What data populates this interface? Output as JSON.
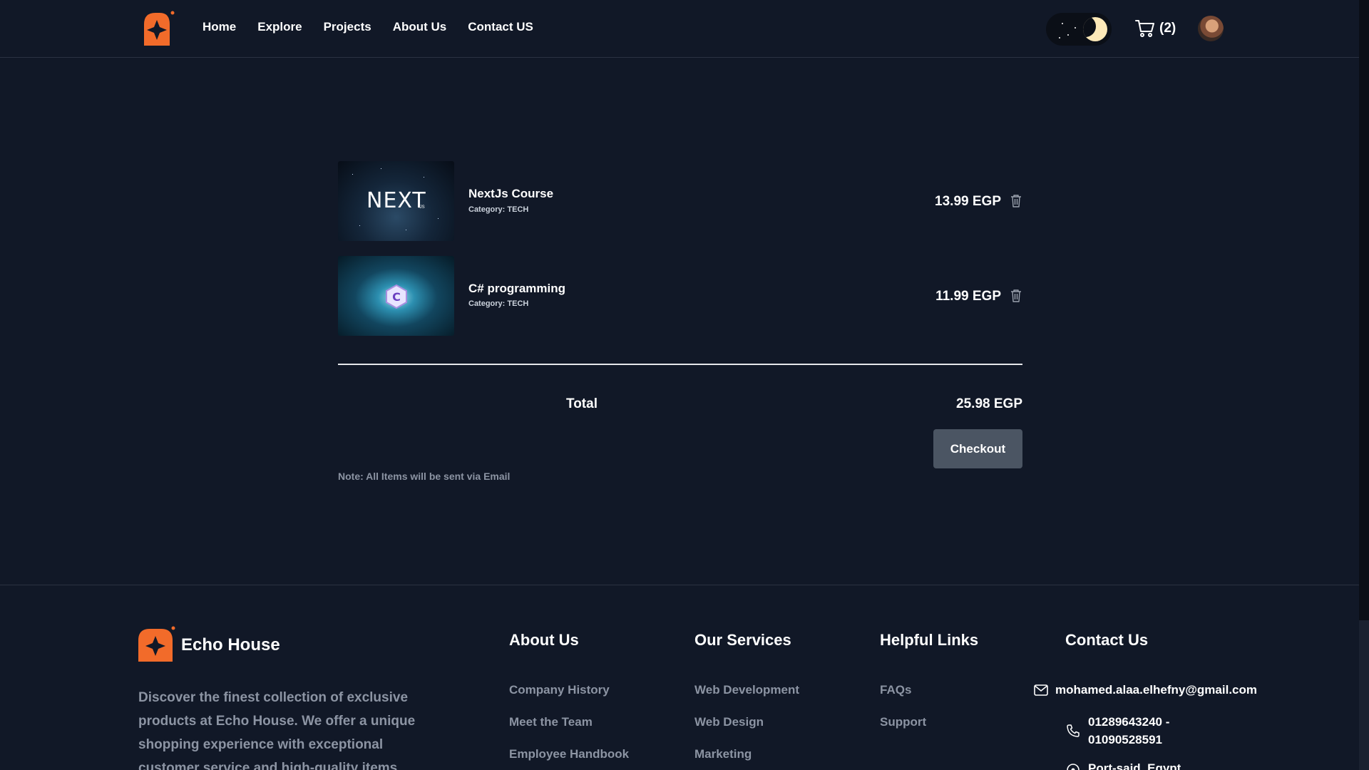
{
  "nav": {
    "items": [
      "Home",
      "Explore",
      "Projects",
      "About Us",
      "Contact US"
    ]
  },
  "cart_badge": {
    "count_text": "(2)"
  },
  "colors": {
    "brand": "#f26b2a",
    "background": "#111827",
    "button": "#4b5563",
    "muted": "#8c94a3"
  },
  "cart": {
    "items": [
      {
        "title": "NextJs Course",
        "category": "Category: TECH",
        "price": "13.99 EGP",
        "thumb_text": "NEXT",
        "thumb_sub": ".JS"
      },
      {
        "title": "C# programming",
        "category": "Category: TECH",
        "price": "11.99 EGP",
        "thumb_text": "C"
      }
    ],
    "total_label": "Total",
    "total_value": "25.98 EGP",
    "checkout_label": "Checkout",
    "note": "Note: All Items will be sent via Email"
  },
  "footer": {
    "brand": "Echo House",
    "description": "Discover the finest collection of exclusive products at Echo House. We offer a unique shopping experience with exceptional customer service and high-quality items",
    "about": {
      "title": "About Us",
      "links": [
        "Company History",
        "Meet the Team",
        "Employee Handbook"
      ]
    },
    "services": {
      "title": "Our Services",
      "links": [
        "Web Development",
        "Web Design",
        "Marketing"
      ]
    },
    "helpful": {
      "title": "Helpful Links",
      "links": [
        "FAQs",
        "Support"
      ]
    },
    "contact": {
      "title": "Contact Us",
      "email": "mohamed.alaa.elhefny@gmail.com",
      "phone_line1": "01289643240 -",
      "phone_line2": "01090528591",
      "address": "Port-said, Egypt"
    }
  }
}
